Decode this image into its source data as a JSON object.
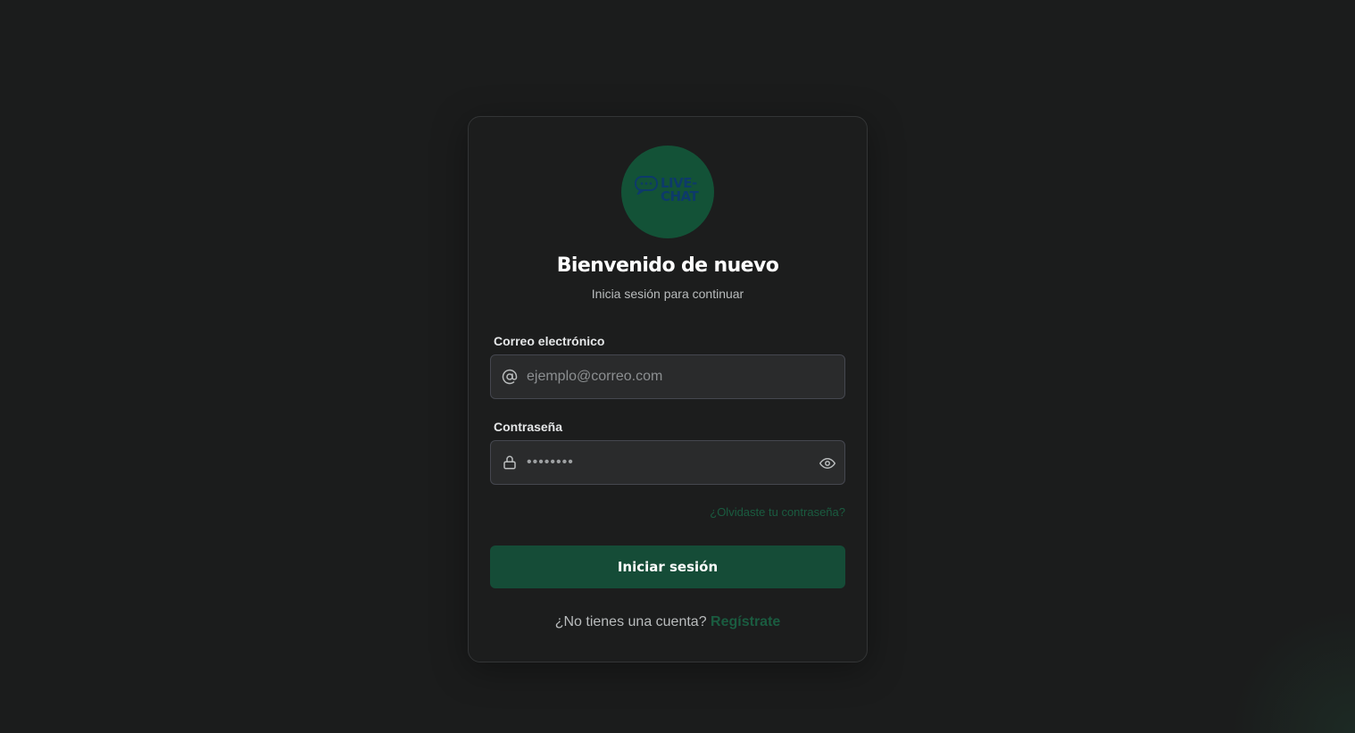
{
  "logo": {
    "text_line1": "LIVE-",
    "text_line2": "CHAT",
    "icon": "chat-bubble-icon",
    "bg_color": "#135237",
    "text_color": "#0d3a6a"
  },
  "header": {
    "title": "Bienvenido de nuevo",
    "subtitle": "Inicia sesión para continuar"
  },
  "email": {
    "label": "Correo electrónico",
    "placeholder": "ejemplo@correo.com",
    "value": "",
    "icon": "at-sign-icon"
  },
  "password": {
    "label": "Contraseña",
    "value": "••••••••",
    "icon": "lock-icon",
    "toggle_icon": "eye-icon"
  },
  "forgot_link": "¿Olvidaste tu contraseña?",
  "submit_label": "Iniciar sesión",
  "signup": {
    "prompt": "¿No tienes una cuenta?",
    "link": "Regístrate"
  },
  "colors": {
    "background": "#1b1c1c",
    "card": "#1c1d1d",
    "accent": "#154c37",
    "link": "#1a5c40"
  }
}
